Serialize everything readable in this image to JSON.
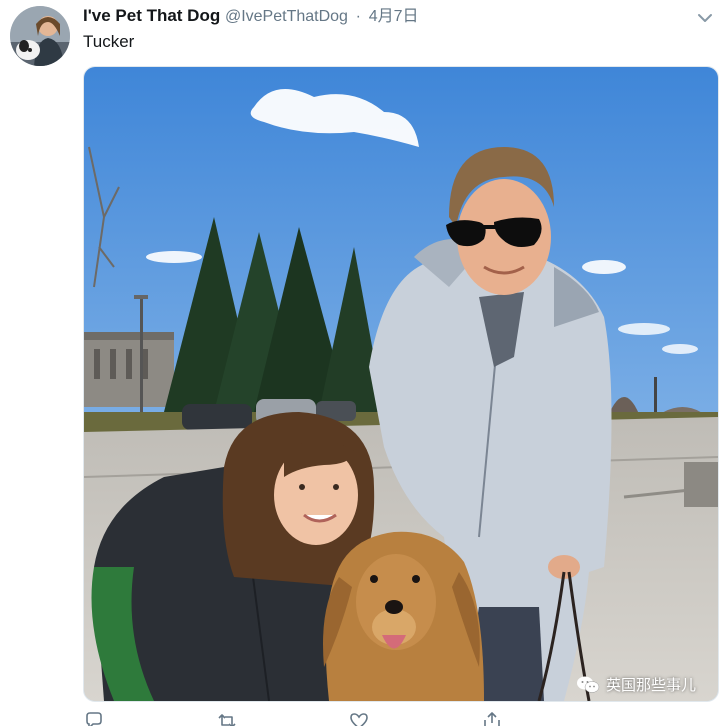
{
  "tweet": {
    "display_name": "I've Pet That Dog",
    "handle": "@IvePetThatDog",
    "separator": "·",
    "date": "4月7日",
    "text": "Tucker"
  },
  "icons": {
    "caret": "chevron-down-icon",
    "reply": "reply-icon",
    "retweet": "retweet-icon",
    "like": "heart-icon",
    "share": "share-icon"
  },
  "watermark": {
    "text": "英国那些事儿"
  },
  "colors": {
    "name": "#14171a",
    "secondary": "#657786",
    "sky": "#6aa6e0",
    "jacket_gray": "#c9d1db",
    "dog_gold": "#b07a3c"
  }
}
